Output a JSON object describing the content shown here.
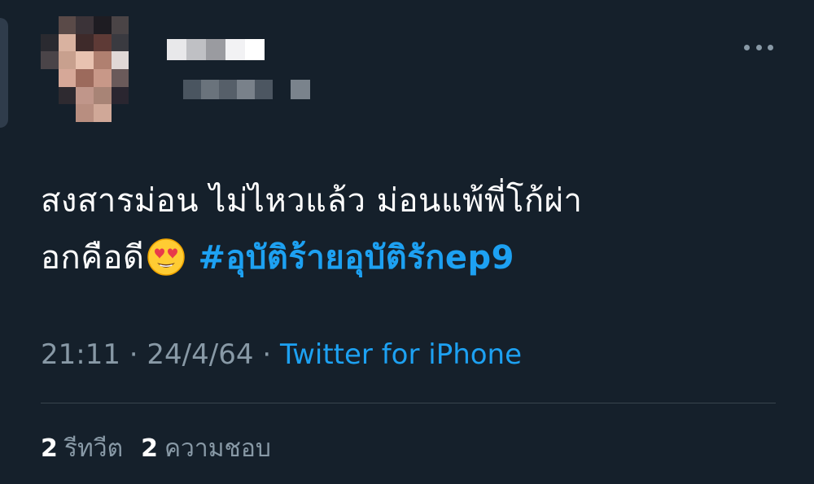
{
  "tweet": {
    "text_line1": "สงสารม่อน ไม่ไหวแล้ว ม่อนแพ้พี่โก้ผ่า",
    "text_line2": "อกคือดี",
    "emoji": "heart-eyes-emoji",
    "hashtag": "#อุบัติร้ายอุบัติรักep9",
    "time": "21:11",
    "separator": "·",
    "date": "24/4/64",
    "source": "Twitter for iPhone"
  },
  "stats": {
    "retweets_count": "2",
    "retweets_label": "รีทวีต",
    "likes_count": "2",
    "likes_label": "ความชอบ"
  },
  "icons": {
    "more": "more-horizontal-icon"
  },
  "colors": {
    "background": "#15202b",
    "text": "#ffffff",
    "muted": "#8899a6",
    "accent": "#1da1f2",
    "divider": "#38444d"
  }
}
